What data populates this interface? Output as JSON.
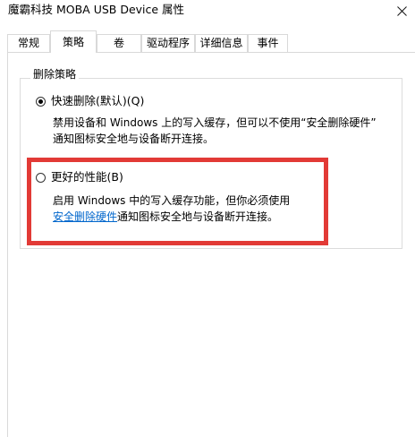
{
  "window": {
    "title": "魔霸科技 MOBA USB Device 属性",
    "close_symbol": "✕"
  },
  "tabs": [
    {
      "label": "常规",
      "active": false
    },
    {
      "label": "策略",
      "active": true
    },
    {
      "label": "卷",
      "active": false
    },
    {
      "label": "驱动程序",
      "active": false
    },
    {
      "label": "详细信息",
      "active": false
    },
    {
      "label": "事件",
      "active": false
    }
  ],
  "removal_policy": {
    "group_label": "删除策略",
    "options": [
      {
        "label": "快速删除(默认)(Q)",
        "checked": true,
        "desc_line1": "禁用设备和 Windows 上的写入缓存，但可以不使用“安全删除硬件”",
        "desc_line2": "通知图标安全地与设备断开连接。"
      },
      {
        "label": "更好的性能(B)",
        "checked": false,
        "desc_line1": "启用 Windows 中的写入缓存功能，但你必须使用",
        "desc_link": "安全删除硬件",
        "desc_line2_rest": "通知图标安全地与设备断开连接。"
      }
    ]
  },
  "colors": {
    "highlight": "#e23a36",
    "link": "#0066cc",
    "border": "#d9d9d9"
  }
}
